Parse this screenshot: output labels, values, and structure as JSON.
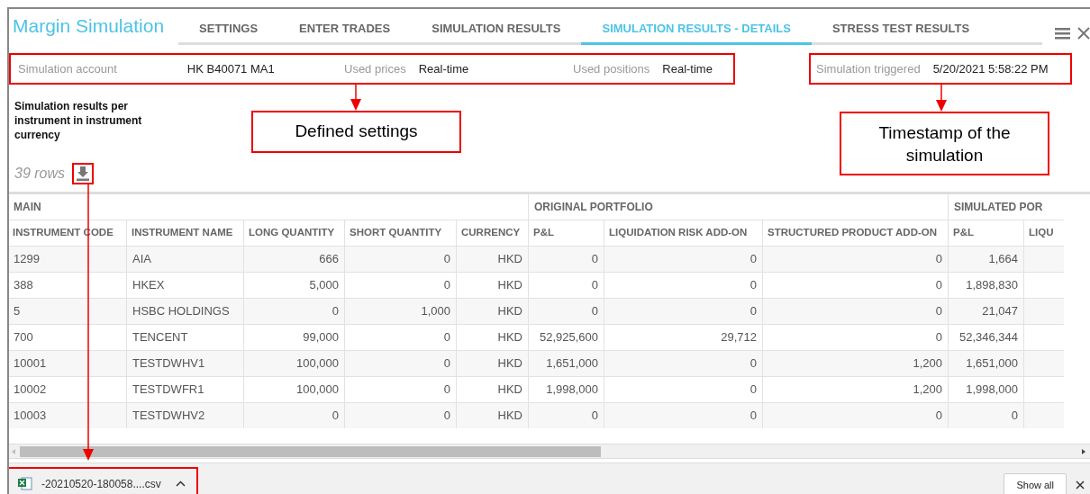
{
  "window": {
    "title": "Margin Simulation"
  },
  "tabs": [
    {
      "label": "SETTINGS",
      "selected": false
    },
    {
      "label": "ENTER TRADES",
      "selected": false
    },
    {
      "label": "SIMULATION RESULTS",
      "selected": false
    },
    {
      "label": "SIMULATION RESULTS - DETAILS",
      "selected": true
    },
    {
      "label": "STRESS TEST RESULTS",
      "selected": false
    }
  ],
  "info": {
    "settings": [
      {
        "label": "Simulation account",
        "value": "HK B40071 MA1"
      },
      {
        "label": "Used prices",
        "value": "Real-time"
      },
      {
        "label": "Used positions",
        "value": "Real-time"
      }
    ],
    "triggered": {
      "label": "Simulation triggered",
      "value": "5/20/2021 5:58:22 PM"
    }
  },
  "section_title": "Simulation results per instrument in instrument currency",
  "row_count": "39 rows",
  "table": {
    "groups": [
      {
        "label": "MAIN"
      },
      {
        "label": "ORIGINAL PORTFOLIO"
      },
      {
        "label": "SIMULATED POR"
      }
    ],
    "columns": [
      {
        "label": "INSTRUMENT CODE"
      },
      {
        "label": "INSTRUMENT NAME"
      },
      {
        "label": "LONG QUANTITY"
      },
      {
        "label": "SHORT QUANTITY"
      },
      {
        "label": "CURRENCY"
      },
      {
        "label": "P&L"
      },
      {
        "label": "LIQUIDATION RISK ADD-ON"
      },
      {
        "label": "STRUCTURED PRODUCT ADD-ON"
      },
      {
        "label": "P&L"
      },
      {
        "label": "LIQU"
      }
    ],
    "rows": [
      [
        "1299",
        "AIA",
        "666",
        "0",
        "HKD",
        "0",
        "0",
        "0",
        "1,664"
      ],
      [
        "388",
        "HKEX",
        "5,000",
        "0",
        "HKD",
        "0",
        "0",
        "0",
        "1,898,830"
      ],
      [
        "5",
        "HSBC HOLDINGS",
        "0",
        "1,000",
        "HKD",
        "0",
        "0",
        "0",
        "21,047"
      ],
      [
        "700",
        "TENCENT",
        "99,000",
        "0",
        "HKD",
        "52,925,600",
        "29,712",
        "0",
        "52,346,344"
      ],
      [
        "10001",
        "TESTDWHV1",
        "100,000",
        "0",
        "HKD",
        "1,651,000",
        "0",
        "1,200",
        "1,651,000"
      ],
      [
        "10002",
        "TESTDWFR1",
        "100,000",
        "0",
        "HKD",
        "1,998,000",
        "0",
        "1,200",
        "1,998,000"
      ],
      [
        "10003",
        "TESTDWHV2",
        "0",
        "0",
        "HKD",
        "0",
        "0",
        "0",
        "0"
      ]
    ]
  },
  "download": {
    "file": "-20210520-180058....csv",
    "show_all": "Show all"
  },
  "annotations": [
    {
      "text": "Defined settings"
    },
    {
      "text": "Timestamp of the simulation"
    }
  ]
}
